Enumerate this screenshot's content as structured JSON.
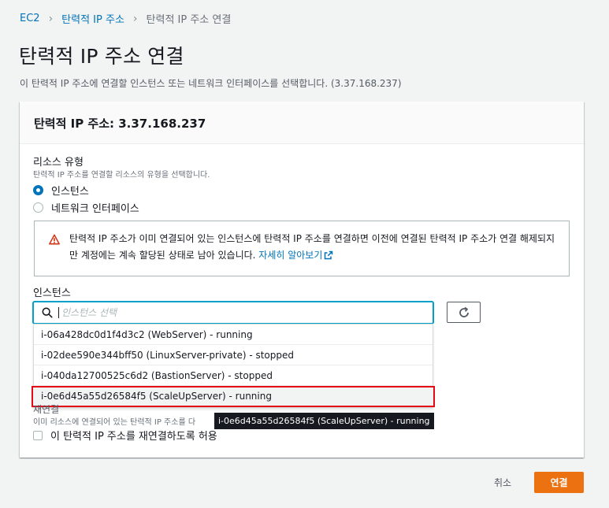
{
  "breadcrumb": {
    "items": [
      "EC2",
      "탄력적 IP 주소",
      "탄력적 IP 주소 연결"
    ]
  },
  "page": {
    "title": "탄력적 IP 주소 연결",
    "description": "이 탄력적 IP 주소에 연결할 인스턴스 또는 네트워크 인터페이스를 선택합니다. (3.37.168.237)"
  },
  "panel": {
    "title": "탄력적 IP 주소: 3.37.168.237",
    "resource_type": {
      "label": "리소스 유형",
      "description": "탄력적 IP 주소를 연결할 리소스의 유형을 선택합니다.",
      "options": [
        "인스턴스",
        "네트워크 인터페이스"
      ],
      "selected": "인스턴스"
    },
    "alert": {
      "text": "탄력적 IP 주소가 이미 연결되어 있는 인스턴스에 탄력적 IP 주소를 연결하면 이전에 연결된 탄력적 IP 주소가 연결 해제되지만 계정에는 계속 할당된 상태로 남아 있습니다.",
      "link": "자세히 알아보기"
    },
    "instance": {
      "label": "인스턴스",
      "placeholder": "인스턴스 선택",
      "options": [
        "i-06a428dc0d1f4d3c2 (WebServer) - running",
        "i-02dee590e344bff50 (LinuxServer-private) - stopped",
        "i-040da12700525c6d2 (BastionServer) - stopped",
        "i-0e6d45a55d26584f5 (ScaleUpServer) - running"
      ],
      "highlighted_index": 3
    },
    "reassociation": {
      "label_partial": "재연결",
      "description_partial": "이미 리소스에 연결되어 있는 탄력적 IP 주소를 다",
      "checkbox_label": "이 탄력적 IP 주소를 재연결하도록 허용"
    },
    "tooltip": "i-0e6d45a55d26584f5 (ScaleUpServer) - running"
  },
  "actions": {
    "cancel": "취소",
    "connect": "연결"
  },
  "colors": {
    "link": "#0073bb",
    "primary_button": "#ec7211",
    "highlight_border": "#e50914",
    "focus": "#00a1c9"
  }
}
